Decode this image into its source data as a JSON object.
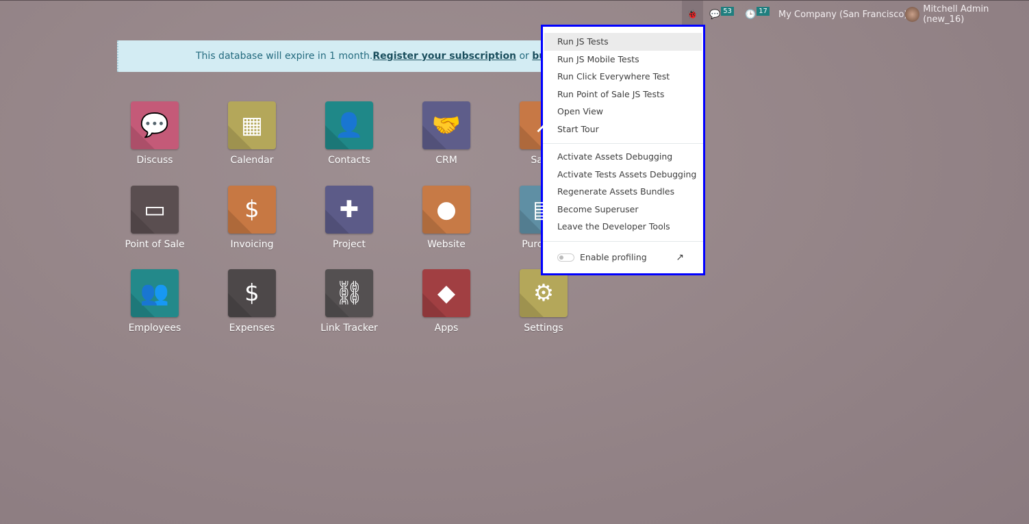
{
  "topbar": {
    "debug_icon": "bug-icon",
    "chat_count": "53",
    "activity_count": "17",
    "company": "My Company (San Francisco)",
    "user": "Mitchell Admin (new_16)"
  },
  "banner": {
    "text": "This database will expire in 1 month. ",
    "register_link": "Register your subscription",
    "or": " or ",
    "buy_link": "buy a subscription"
  },
  "apps": [
    {
      "label": "Discuss",
      "icon": "chat-bubble-icon",
      "color": "#c45a78"
    },
    {
      "label": "Calendar",
      "icon": "calendar-icon",
      "color": "#b4a75a"
    },
    {
      "label": "Contacts",
      "icon": "address-book-icon",
      "color": "#1f8888"
    },
    {
      "label": "CRM",
      "icon": "handshake-icon",
      "color": "#5e5d8a"
    },
    {
      "label": "Sales",
      "icon": "chart-icon",
      "color": "#c77845"
    },
    {
      "label": "Point of Sale",
      "icon": "store-icon",
      "color": "#5a4e50"
    },
    {
      "label": "Invoicing",
      "icon": "invoice-icon",
      "color": "#c77843"
    },
    {
      "label": "Project",
      "icon": "puzzle-icon",
      "color": "#5c5b88"
    },
    {
      "label": "Website",
      "icon": "globe-icon",
      "color": "#c77a46"
    },
    {
      "label": "Purchase",
      "icon": "credit-card-icon",
      "color": "#5f8fa4"
    },
    {
      "label": "Employees",
      "icon": "users-icon",
      "color": "#23898a"
    },
    {
      "label": "Expenses",
      "icon": "user-dollar-icon",
      "color": "#4d4849"
    },
    {
      "label": "Link Tracker",
      "icon": "link-icon",
      "color": "#545051"
    },
    {
      "label": "Apps",
      "icon": "cubes-icon",
      "color": "#a13f42"
    },
    {
      "label": "Settings",
      "icon": "gear-icon",
      "color": "#b4a75a"
    }
  ],
  "debug_menu": {
    "group1": [
      "Run JS Tests",
      "Run JS Mobile Tests",
      "Run Click Everywhere Test",
      "Run Point of Sale JS Tests",
      "Open View",
      "Start Tour"
    ],
    "group2": [
      "Activate Assets Debugging",
      "Activate Tests Assets Debugging",
      "Regenerate Assets Bundles",
      "Become Superuser",
      "Leave the Developer Tools"
    ],
    "profiling_label": "Enable profiling",
    "profiling_enabled": false
  }
}
